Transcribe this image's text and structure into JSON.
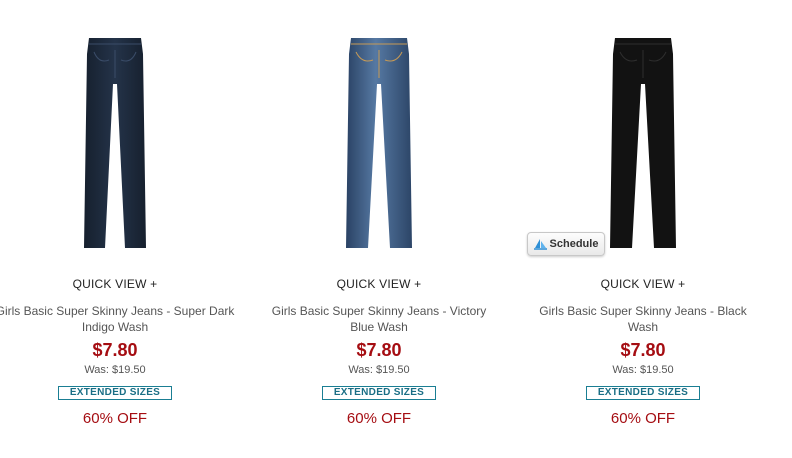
{
  "products": [
    {
      "quick_view": "QUICK VIEW +",
      "name": "Girls Basic Super Skinny Jeans - Super Dark Indigo Wash",
      "price": "$7.80",
      "was": "Was: $19.50",
      "badge": "EXTENDED SIZES",
      "discount": "60% OFF",
      "color": "#1f2c3f"
    },
    {
      "quick_view": "QUICK VIEW +",
      "name": "Girls Basic Super Skinny Jeans - Victory Blue Wash",
      "price": "$7.80",
      "was": "Was: $19.50",
      "badge": "EXTENDED SIZES",
      "discount": "60% OFF",
      "color": "#355079"
    },
    {
      "quick_view": "QUICK VIEW +",
      "name": "Girls Basic Super Skinny Jeans - Black Wash",
      "price": "$7.80",
      "was": "Was: $19.50",
      "badge": "EXTENDED SIZES",
      "discount": "60% OFF",
      "color": "#121212"
    }
  ],
  "schedule_button": {
    "label": "Schedule",
    "icon": "sail-icon"
  },
  "colors": {
    "price": "#a50d12",
    "badge_border": "#1a7e93",
    "badge_text": "#1a6e85"
  }
}
